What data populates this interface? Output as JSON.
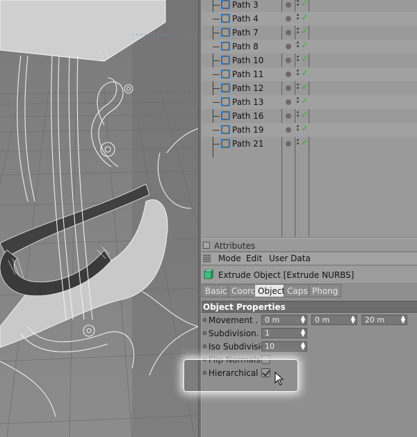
{
  "object_manager": {
    "items": [
      {
        "label": "Path 3"
      },
      {
        "label": "Path 4"
      },
      {
        "label": "Path 7"
      },
      {
        "label": "Path 8"
      },
      {
        "label": "Path 10"
      },
      {
        "label": "Path 11"
      },
      {
        "label": "Path 12"
      },
      {
        "label": "Path 13"
      },
      {
        "label": "Path 16"
      },
      {
        "label": "Path 19"
      },
      {
        "label": "Path 21"
      }
    ],
    "check_glyph": "✓",
    "enabled_color": "#2fb52f"
  },
  "attributes": {
    "title": "Attributes",
    "menu": {
      "mode": "Mode",
      "edit": "Edit",
      "user_data": "User Data"
    },
    "object_name": "Extrude Object [Extrude NURBS]",
    "tabs": {
      "basic": "Basic",
      "coord": "Coord.",
      "object": "Object",
      "caps": "Caps",
      "phong": "Phong"
    },
    "section_title": "Object Properties",
    "props": {
      "movement": {
        "label": "Movement . . .",
        "x": "0 m",
        "y": "0 m",
        "z": "20 m"
      },
      "subdivision": {
        "label": "Subdivision. . .",
        "value": "1"
      },
      "iso_subdivision": {
        "label": "Iso Subdivision",
        "value": "10"
      },
      "flip_normals": {
        "label": "Flip Normals . .",
        "checked": false
      },
      "hierarchical": {
        "label": "Hierarchical . .",
        "checked": true
      }
    }
  }
}
